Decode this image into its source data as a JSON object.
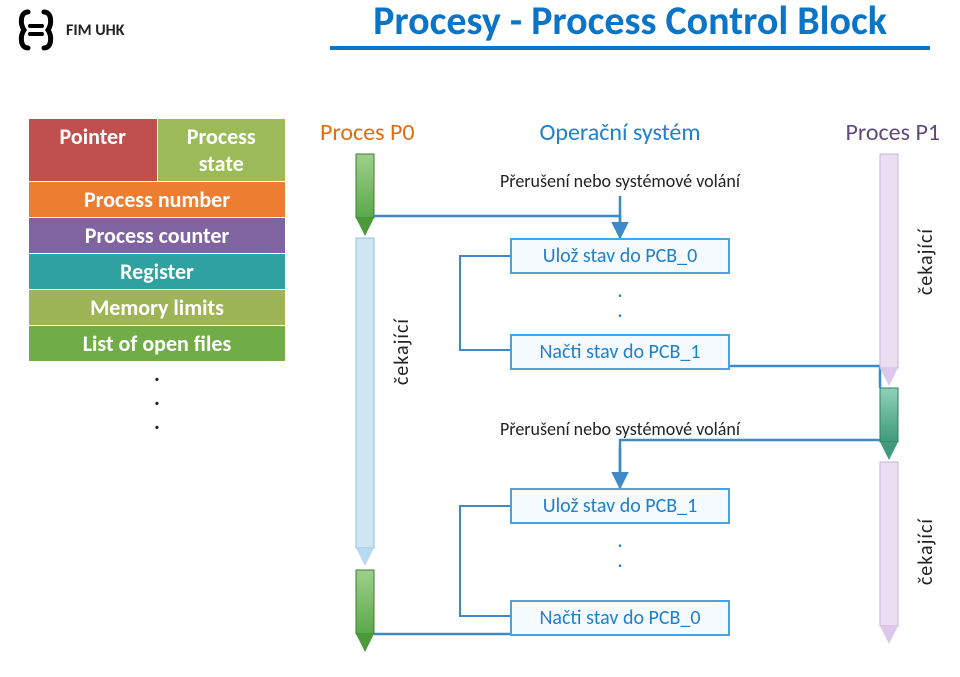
{
  "logo_text": "FIM UHK",
  "title": "Procesy - Process Control Block",
  "pcb": {
    "pointer": "Pointer",
    "state": "Process state",
    "number": "Process number",
    "counter": "Process counter",
    "register": "Register",
    "memory": "Memory limits",
    "files": "List of open files",
    "dots": ".\n.\n."
  },
  "diagram": {
    "p0": "Proces P0",
    "os": "Operační systém",
    "p1": "Proces P1",
    "interrupt": "Přerušení nebo systémové volání",
    "save0": "Ulož stav do PCB_0",
    "load1": "Načti stav do PCB_1",
    "save1": "Ulož stav do PCB_1",
    "load0": "Načti stav do PCB_0",
    "dots": ".\n.",
    "waiting": "čekající"
  },
  "colors": {
    "title": "#0a74c7",
    "pointer": "#c0504d",
    "state": "#9bbb59",
    "number": "#ed7d31",
    "counter": "#8064a2",
    "register": "#2fa1a1",
    "memory": "#9db556",
    "files": "#70ad47",
    "p0": "#e46c0a",
    "os": "#1f80cc",
    "p1": "#604a7b"
  },
  "chart_data": {
    "type": "table",
    "title": "Context switch between Proces P0 and Proces P1 via Operační systém",
    "pcb_fields": [
      "Pointer",
      "Process state",
      "Process number",
      "Process counter",
      "Register",
      "Memory limits",
      "List of open files"
    ],
    "lanes": [
      "Proces P0",
      "Operační systém",
      "Proces P1"
    ],
    "sequence": [
      {
        "lane": "Proces P0",
        "event": "running"
      },
      {
        "lane": "Operační systém",
        "event": "Přerušení nebo systémové volání"
      },
      {
        "lane": "Operační systém",
        "event": "Ulož stav do PCB_0"
      },
      {
        "lane": "Operační systém",
        "event": "Načti stav do PCB_1"
      },
      {
        "lane": "Proces P1",
        "event": "running",
        "p0_state": "čekající"
      },
      {
        "lane": "Operační systém",
        "event": "Přerušení nebo systémové volání"
      },
      {
        "lane": "Operační systém",
        "event": "Ulož stav do PCB_1"
      },
      {
        "lane": "Operační systém",
        "event": "Načti stav do PCB_0"
      },
      {
        "lane": "Proces P0",
        "event": "running",
        "p1_state": "čekající"
      }
    ]
  }
}
